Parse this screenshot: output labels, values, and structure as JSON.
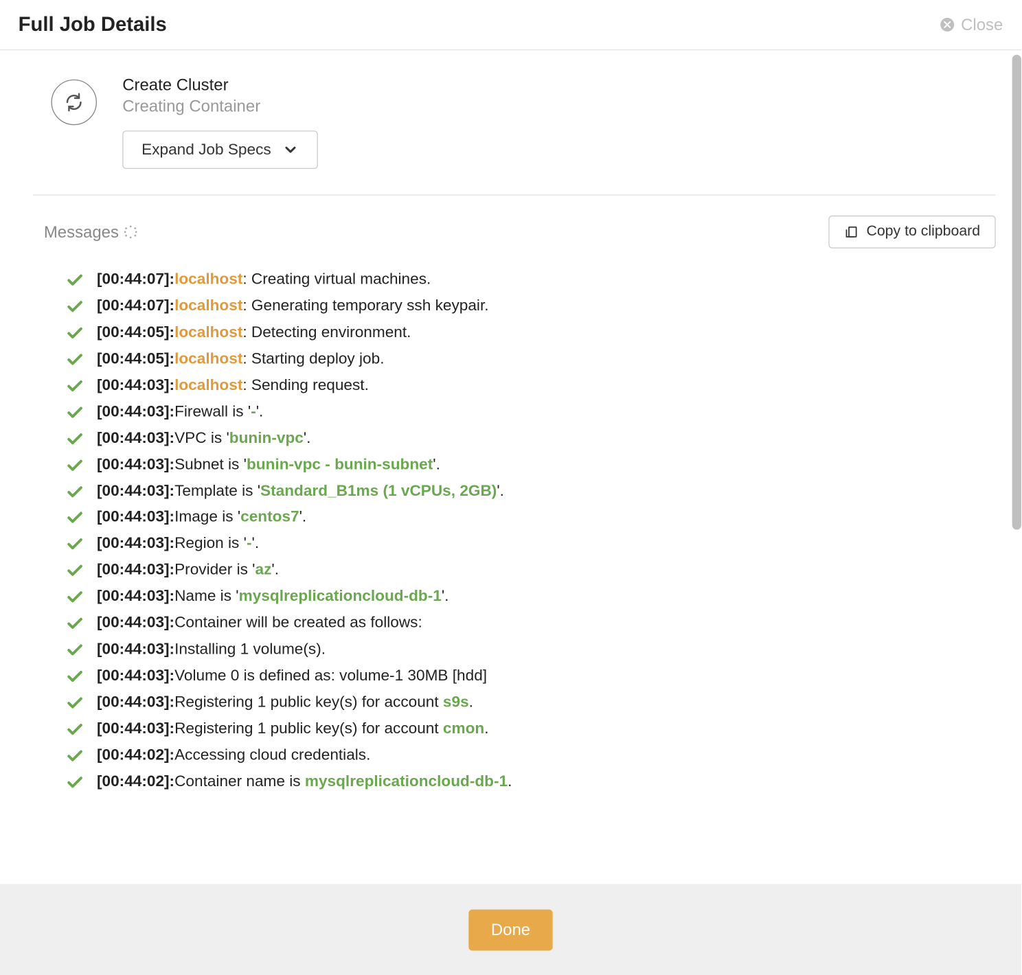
{
  "header": {
    "title": "Full Job Details",
    "close_label": "Close"
  },
  "job": {
    "title": "Create Cluster",
    "subtitle": "Creating Container",
    "expand_label": "Expand Job Specs"
  },
  "messages_section": {
    "label": "Messages",
    "copy_label": "Copy to clipboard"
  },
  "footer": {
    "done_label": "Done"
  },
  "colors": {
    "orange": "#e09a3c",
    "green": "#6aa84f",
    "accent_btn": "#e8a94a"
  },
  "messages": [
    {
      "time": "[00:44:07]:",
      "host": "localhost",
      "segments": [
        {
          "t": ": Creating virtual machines."
        }
      ]
    },
    {
      "time": "[00:44:07]:",
      "host": "localhost",
      "segments": [
        {
          "t": ": Generating temporary ssh keypair."
        }
      ]
    },
    {
      "time": "[00:44:05]:",
      "host": "localhost",
      "segments": [
        {
          "t": ": Detecting environment."
        }
      ]
    },
    {
      "time": "[00:44:05]:",
      "host": "localhost",
      "segments": [
        {
          "t": ": Starting deploy job."
        }
      ]
    },
    {
      "time": "[00:44:03]:",
      "host": "localhost",
      "segments": [
        {
          "t": ": Sending request."
        }
      ]
    },
    {
      "time": "[00:44:03]:",
      "segments": [
        {
          "t": "Firewall is '"
        },
        {
          "t": "-",
          "c": "green"
        },
        {
          "t": "'."
        }
      ]
    },
    {
      "time": "[00:44:03]:",
      "segments": [
        {
          "t": "VPC is '"
        },
        {
          "t": "bunin-vpc",
          "c": "green"
        },
        {
          "t": "'."
        }
      ]
    },
    {
      "time": "[00:44:03]:",
      "segments": [
        {
          "t": "Subnet is '"
        },
        {
          "t": "bunin-vpc - bunin-subnet",
          "c": "green"
        },
        {
          "t": "'."
        }
      ]
    },
    {
      "time": "[00:44:03]:",
      "segments": [
        {
          "t": "Template is '"
        },
        {
          "t": "Standard_B1ms (1 vCPUs, 2GB)",
          "c": "green"
        },
        {
          "t": "'."
        }
      ]
    },
    {
      "time": "[00:44:03]:",
      "segments": [
        {
          "t": "Image is '"
        },
        {
          "t": "centos7",
          "c": "green"
        },
        {
          "t": "'."
        }
      ]
    },
    {
      "time": "[00:44:03]:",
      "segments": [
        {
          "t": "Region is '"
        },
        {
          "t": "-",
          "c": "green"
        },
        {
          "t": "'."
        }
      ]
    },
    {
      "time": "[00:44:03]:",
      "segments": [
        {
          "t": "Provider is '"
        },
        {
          "t": "az",
          "c": "green"
        },
        {
          "t": "'."
        }
      ]
    },
    {
      "time": "[00:44:03]:",
      "segments": [
        {
          "t": "Name is '"
        },
        {
          "t": "mysqlreplicationcloud-db-1",
          "c": "green"
        },
        {
          "t": "'."
        }
      ]
    },
    {
      "time": "[00:44:03]:",
      "segments": [
        {
          "t": "Container will be created as follows:"
        }
      ]
    },
    {
      "time": "[00:44:03]:",
      "segments": [
        {
          "t": "Installing 1 volume(s)."
        }
      ]
    },
    {
      "time": "[00:44:03]:",
      "segments": [
        {
          "t": "Volume 0 is defined as: volume-1 30MB [hdd]"
        }
      ]
    },
    {
      "time": "[00:44:03]:",
      "segments": [
        {
          "t": "Registering 1 public key(s) for account "
        },
        {
          "t": "s9s",
          "c": "green"
        },
        {
          "t": "."
        }
      ]
    },
    {
      "time": "[00:44:03]:",
      "segments": [
        {
          "t": "Registering 1 public key(s) for account "
        },
        {
          "t": "cmon",
          "c": "green"
        },
        {
          "t": "."
        }
      ]
    },
    {
      "time": "[00:44:02]:",
      "segments": [
        {
          "t": "Accessing cloud credentials."
        }
      ]
    },
    {
      "time": "[00:44:02]:",
      "segments": [
        {
          "t": "Container name is "
        },
        {
          "t": "mysqlreplicationcloud-db-1",
          "c": "green"
        },
        {
          "t": "."
        }
      ]
    }
  ]
}
